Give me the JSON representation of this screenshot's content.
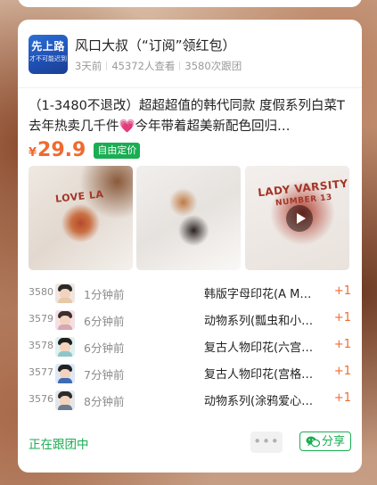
{
  "group": {
    "avatar_big": "先上路",
    "avatar_small": "才不可能迟到",
    "title": "风口大叔（“订阅”领红包）",
    "posted": "3天前",
    "views": "45372人查看",
    "followers": "3580次跟团"
  },
  "product": {
    "description": "（1-3480不退改）超超超值的韩代同款 度假系列白菜T 去年热卖几千件💗今年带着超美新配色回归…",
    "price_symbol": "¥",
    "price": "29.9",
    "price_tag": "自由定价",
    "photo_print_1": "LOVE LA",
    "photo_print_3_line1": "LADY VARSITY",
    "photo_print_3_line2": "NUMBER 13"
  },
  "orders": [
    {
      "num": "3580",
      "time": "1分钟前",
      "item": "韩版字母印花(A M…",
      "qty": "+1",
      "hair": "#2a2a2a",
      "shirt": "#e6c9a8"
    },
    {
      "num": "3579",
      "time": "6分钟前",
      "item": "动物系列(瓢虫和小…",
      "qty": "+1",
      "hair": "#3a2f2c",
      "shirt": "#d8a6b4"
    },
    {
      "num": "3578",
      "time": "6分钟前",
      "item": "复古人物印花(六宫…",
      "qty": "+1",
      "hair": "#1f1f1f",
      "shirt": "#8ec6c9"
    },
    {
      "num": "3577",
      "time": "7分钟前",
      "item": "复古人物印花(宫格…",
      "qty": "+1",
      "hair": "#222222",
      "shirt": "#3f6bb5"
    },
    {
      "num": "3576",
      "time": "8分钟前",
      "item": "动物系列(涂鸦爱心…",
      "qty": "+1",
      "hair": "#2b2b2b",
      "shirt": "#6a7b8e"
    }
  ],
  "footer": {
    "status": "正在跟团中",
    "more": "•••",
    "share": "分享"
  },
  "colors": {
    "accent_green": "#1aad52",
    "price_orange": "#f06a30"
  }
}
